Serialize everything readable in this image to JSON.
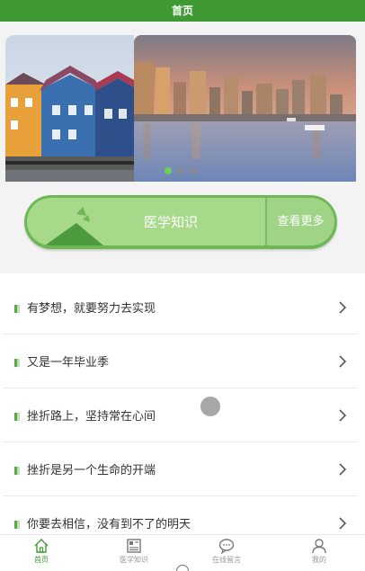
{
  "header": {
    "title": "首页"
  },
  "banner": {
    "slide_count": 3,
    "active_index": 0
  },
  "knowledge": {
    "title": "医学知识",
    "more_label": "查看更多"
  },
  "list": {
    "items": [
      {
        "text": "有梦想，就要努力去实现"
      },
      {
        "text": "又是一年毕业季"
      },
      {
        "text": "挫折路上，坚持常在心间"
      },
      {
        "text": "挫折是另一个生命的开端"
      },
      {
        "text": "你要去相信，没有到不了的明天"
      }
    ]
  },
  "tabbar": {
    "items": [
      {
        "label": "首页",
        "icon": "home-icon",
        "active": true
      },
      {
        "label": "医学知识",
        "icon": "book-icon",
        "active": false
      },
      {
        "label": "在线留言",
        "icon": "chat-icon",
        "active": false
      },
      {
        "label": "我的",
        "icon": "user-icon",
        "active": false
      }
    ]
  },
  "colors": {
    "primary": "#3f9a34",
    "card": "#a6d98a",
    "active_dot": "#6ccf56"
  }
}
